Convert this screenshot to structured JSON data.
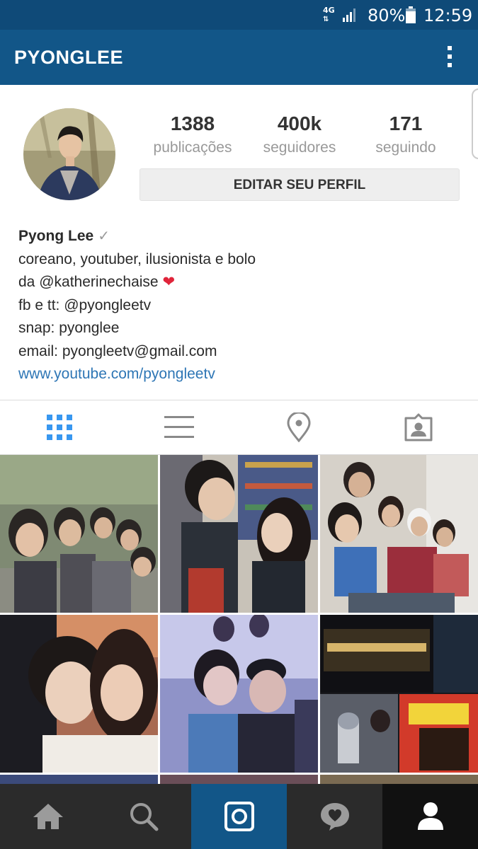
{
  "status_bar": {
    "network": "4G",
    "battery_percent": "80%",
    "time": "12:59"
  },
  "app_bar": {
    "title": "PYONGLEE",
    "menu_icon": "more-vert-icon"
  },
  "profile": {
    "stats": [
      {
        "value": "1388",
        "label": "publicações"
      },
      {
        "value": "400k",
        "label": "seguidores"
      },
      {
        "value": "171",
        "label": "seguindo"
      }
    ],
    "edit_button": "EDITAR SEU PERFIL",
    "name": "Pyong Lee",
    "verified_mark": "✓",
    "bio_lines": [
      "coreano, youtuber, ilusionista e bolo",
      "da @katherinechaise",
      "fb e tt: @pyongleetv",
      "snap: pyonglee",
      "email: pyongleetv@gmail.com"
    ],
    "heart": "❤",
    "website": "www.youtube.com/pyongleetv"
  },
  "view_tabs": [
    {
      "icon": "grid-view-icon",
      "active": true
    },
    {
      "icon": "list-view-icon",
      "active": false
    },
    {
      "icon": "location-pin-icon",
      "active": false
    },
    {
      "icon": "tagged-photos-icon",
      "active": false
    }
  ],
  "bottom_nav": [
    {
      "icon": "home-icon",
      "active": false
    },
    {
      "icon": "search-icon",
      "active": false
    },
    {
      "icon": "camera-icon",
      "active": false
    },
    {
      "icon": "activity-heart-icon",
      "active": false
    },
    {
      "icon": "profile-icon",
      "active": true
    }
  ],
  "colors": {
    "status_bar": "#0f4a78",
    "app_bar": "#125688",
    "active_tab": "#3897f0",
    "link": "#2e76b5",
    "bottom_nav": "#2b2b2b",
    "camera_tab": "#125688",
    "active_nav": "#111111"
  }
}
